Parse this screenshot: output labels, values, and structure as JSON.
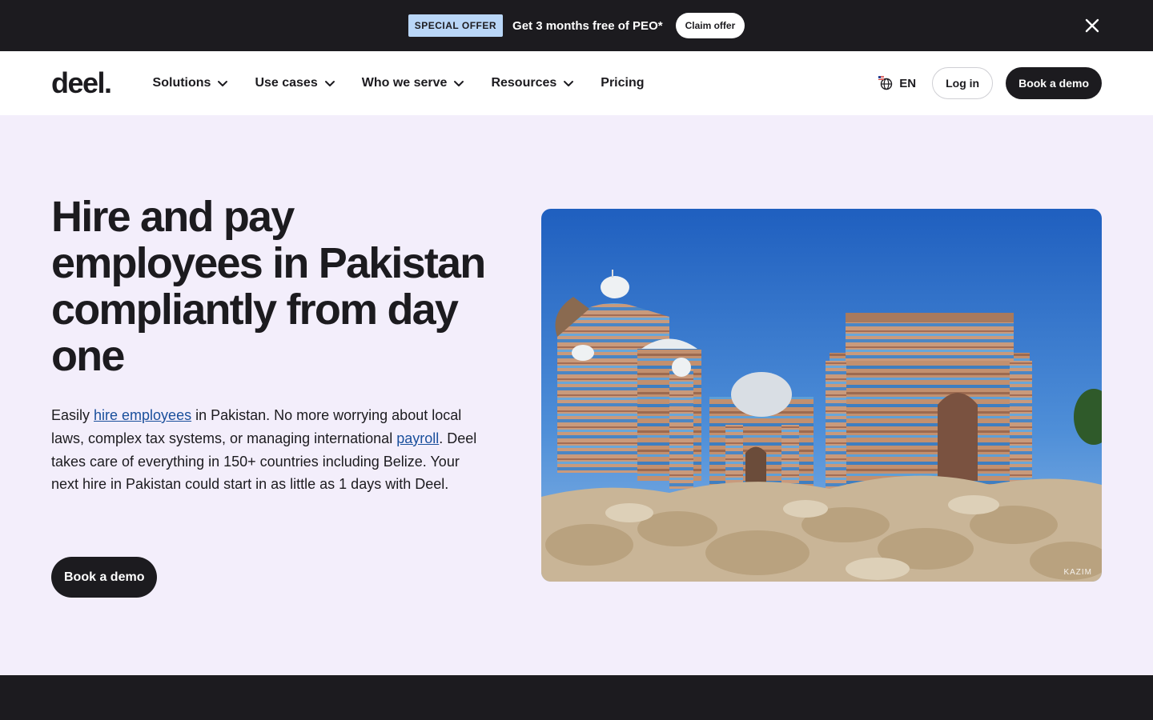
{
  "promo": {
    "badge": "SPECIAL OFFER",
    "text": "Get 3 months free of PEO*",
    "cta": "Claim offer",
    "close_icon": "close-icon"
  },
  "nav": {
    "logo": "deel.",
    "items": [
      {
        "label": "Solutions",
        "has_dropdown": true
      },
      {
        "label": "Use cases",
        "has_dropdown": true
      },
      {
        "label": "Who we serve",
        "has_dropdown": true
      },
      {
        "label": "Resources",
        "has_dropdown": true
      },
      {
        "label": "Pricing",
        "has_dropdown": false
      }
    ],
    "language": "EN",
    "language_icon": "globe-icon",
    "login": "Log in",
    "book_demo": "Book a demo"
  },
  "hero": {
    "title": "Hire and pay employees in Pakistan compliantly from day one",
    "desc_part1": "Easily ",
    "desc_link1": "hire employees",
    "desc_part2": " in Pakistan. No more worrying about local laws, complex tax systems, or managing international ",
    "desc_link2": "payroll",
    "desc_part3": ". Deel takes care of everything in 150+ countries including Belize. Your next hire in Pakistan could start in as little as 1 days with Deel.",
    "cta": "Book a demo",
    "image_credit": "KAZIM"
  },
  "colors": {
    "dark": "#1c1b1f",
    "hero_bg": "#f3eefb",
    "badge_bg": "#b9d6f7",
    "link": "#1a4f9c"
  }
}
